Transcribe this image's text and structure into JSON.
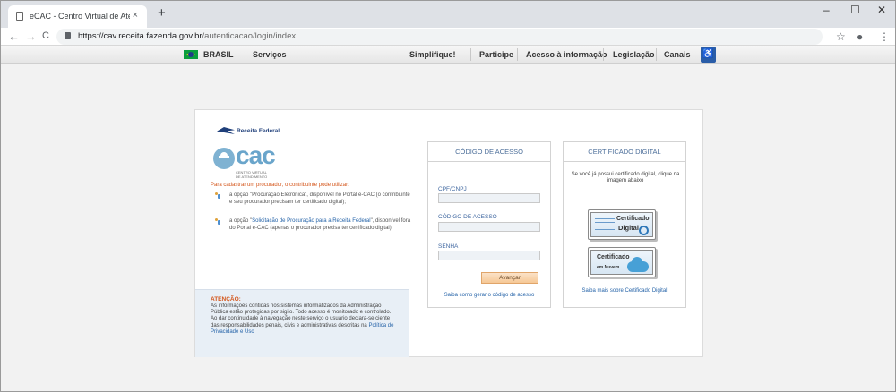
{
  "browser": {
    "tab_title": "eCAC - Centro Virtual de Atendimento",
    "tab_close": "×",
    "new_tab": "+",
    "window": {
      "minimize": "–",
      "maximize": "☐",
      "close": "✕"
    },
    "nav": {
      "back": "←",
      "forward": "→",
      "reload": "C"
    },
    "url_host": "https://cav.receita.fazenda.gov.br",
    "url_path": "/autenticacao/login/index",
    "toolbar_icons": {
      "star": "☆",
      "account": "●",
      "menu": "⋮"
    }
  },
  "govbar": {
    "brasil": "BRASIL",
    "servicos": "Serviços",
    "links": [
      "Simplifique!",
      "Participe",
      "Acesso à informação",
      "Legislação",
      "Canais"
    ],
    "badge": "♿"
  },
  "left": {
    "logo_text": "Receita Federal",
    "ecac_text": "cac",
    "ecac_sub1": "CENTRO VIRTUAL",
    "ecac_sub2": "DE ATENDIMENTO",
    "intro": "Para cadastrar um procurador, o contribuinte pode utilizar:",
    "bullet1": "a opção \"Procuração Eletrônica\", disponível no Portal e-CAC (o contribuinte e seu procurador precisam ter certificado digital);",
    "bullet2_pre": "a opção \"",
    "bullet2_link": "Solicitação de Procuração para a Receita Federal",
    "bullet2_post": "\", disponível fora do Portal e-CAC (apenas o procurador precisa ter certificado digital).",
    "atencao_title": "ATENÇÃO:",
    "atencao_text": "As informações contidas nos sistemas informatizados da Administração Pública estão protegidas por sigilo. Todo acesso é monitorado e controlado. Ao dar continuidade à navegação neste serviço o usuário declara-se ciente das responsabilidades penais, civis e administrativas descritas na ",
    "atencao_link": "Política de Privacidade e Uso"
  },
  "codigo": {
    "header": "CÓDIGO DE ACESSO",
    "cpf_label": "CPF/CNPJ",
    "codigo_label": "CÓDIGO DE ACESSO",
    "senha_label": "SENHA",
    "cpf_value": "",
    "codigo_value": "",
    "senha_value": "",
    "button": "Avançar",
    "help_link": "Saiba como gerar o código de acesso"
  },
  "certificado": {
    "header": "CERTIFICADO DIGITAL",
    "text": "Se você já possui certificado digital, clique na imagem abaixo",
    "cert1_line1": "Certificado",
    "cert1_line2": "Digital",
    "cert2_line1": "Certificado",
    "cert2_line2": "em Nuvem",
    "help_link": "Saiba mais sobre Certificado Digital"
  }
}
